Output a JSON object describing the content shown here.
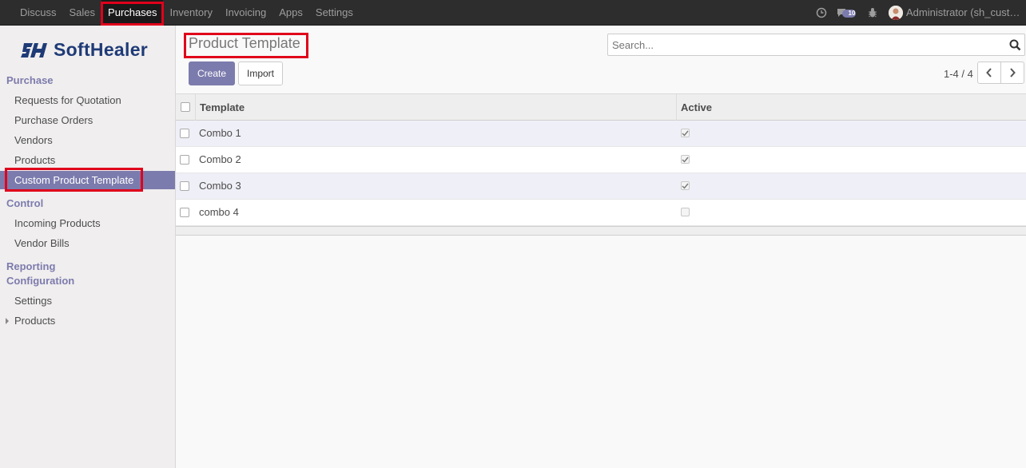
{
  "topbar": {
    "menu": [
      "Discuss",
      "Sales",
      "Purchases",
      "Inventory",
      "Invoicing",
      "Apps",
      "Settings"
    ],
    "active_menu": "Purchases",
    "notification_count": "10",
    "user_label": "Administrator (sh_custom_product_template)"
  },
  "sidebar": {
    "brand": "SoftHealer",
    "section_purchase": "Purchase",
    "purchase_items": [
      "Requests for Quotation",
      "Purchase Orders",
      "Vendors",
      "Products",
      "Custom Product Template"
    ],
    "section_control": "Control",
    "control_items": [
      "Incoming Products",
      "Vendor Bills"
    ],
    "section_reporting": "Reporting",
    "section_configuration": "Configuration",
    "configuration_items": [
      "Settings",
      "Products"
    ]
  },
  "main": {
    "breadcrumb": "Product Template",
    "search": {
      "placeholder": "Search..."
    },
    "create_label": "Create",
    "import_label": "Import",
    "pager": "1-4 / 4",
    "table": {
      "columns": [
        "Template",
        "Active"
      ],
      "rows": [
        {
          "template": "Combo 1",
          "active": true
        },
        {
          "template": "Combo 2",
          "active": true
        },
        {
          "template": "Combo 3",
          "active": true
        },
        {
          "template": "combo 4",
          "active": false
        }
      ]
    }
  },
  "colors": {
    "navbar": "#2d2d2d",
    "accent": "#7c7bad",
    "highlight": "#e0001b"
  }
}
